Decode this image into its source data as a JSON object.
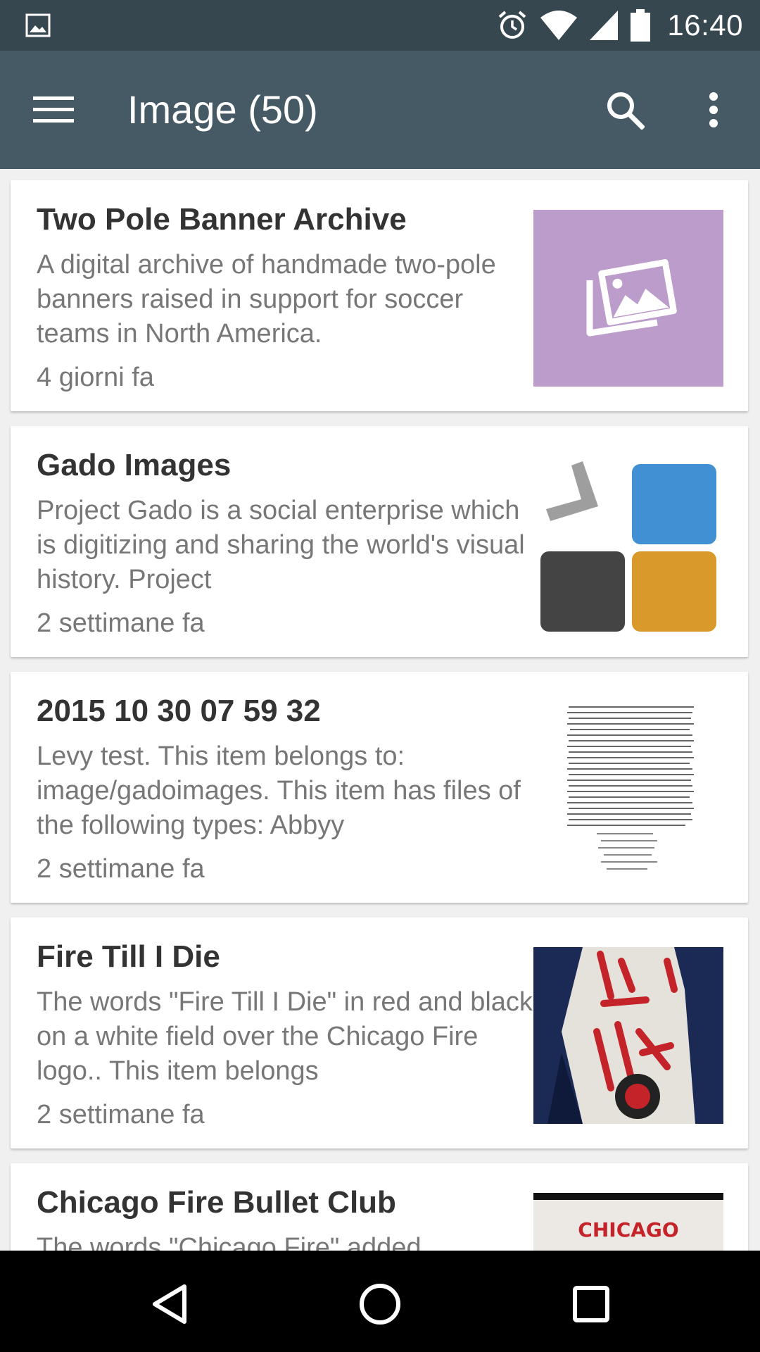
{
  "status_bar": {
    "time": "16:40",
    "icons": [
      "gallery-icon",
      "alarm-icon",
      "wifi-icon",
      "signal-icon",
      "battery-icon"
    ]
  },
  "app_bar": {
    "title": "Image (50)",
    "icons": [
      "menu-icon",
      "search-icon",
      "more-vert-icon"
    ]
  },
  "items": [
    {
      "title": "Two Pole Banner Archive",
      "description": "A digital archive of handmade two-pole banners raised in support for soccer teams in North America.",
      "time": "4 giorni fa",
      "thumbnail": "placeholder-image-icon",
      "thumbnail_color": "#bb9ccb"
    },
    {
      "title": "Gado Images",
      "description": "Project Gado is a social enterprise which is digitizing and sharing the world's visual history. Project",
      "time": "2 settimane fa",
      "thumbnail": "gado-logo",
      "logo_colors": [
        "#4090d3",
        "#444444",
        "#d99a2b",
        "#9e9e9e"
      ]
    },
    {
      "title": "2015 10 30 07 59 32",
      "description": "Levy test. This item belongs to: image/gadoimages. This item has files of the following types: Abbyy",
      "time": "2 settimane fa",
      "thumbnail": "document-scan"
    },
    {
      "title": "Fire Till I Die",
      "description": "The words \"Fire Till I Die\" in red and black on a white field over the Chicago Fire logo.. This item belongs",
      "time": "2 settimane fa",
      "thumbnail": "banner-photo",
      "thumbnail_color": "#1a2a55"
    },
    {
      "title": "Chicago Fire Bullet Club",
      "description": "The words \"Chicago Fire\" added",
      "time": "",
      "thumbnail": "banner-photo",
      "thumbnail_text": "CHICAGO"
    }
  ],
  "nav_bar": {
    "icons": [
      "back-icon",
      "home-icon",
      "recents-icon"
    ]
  }
}
